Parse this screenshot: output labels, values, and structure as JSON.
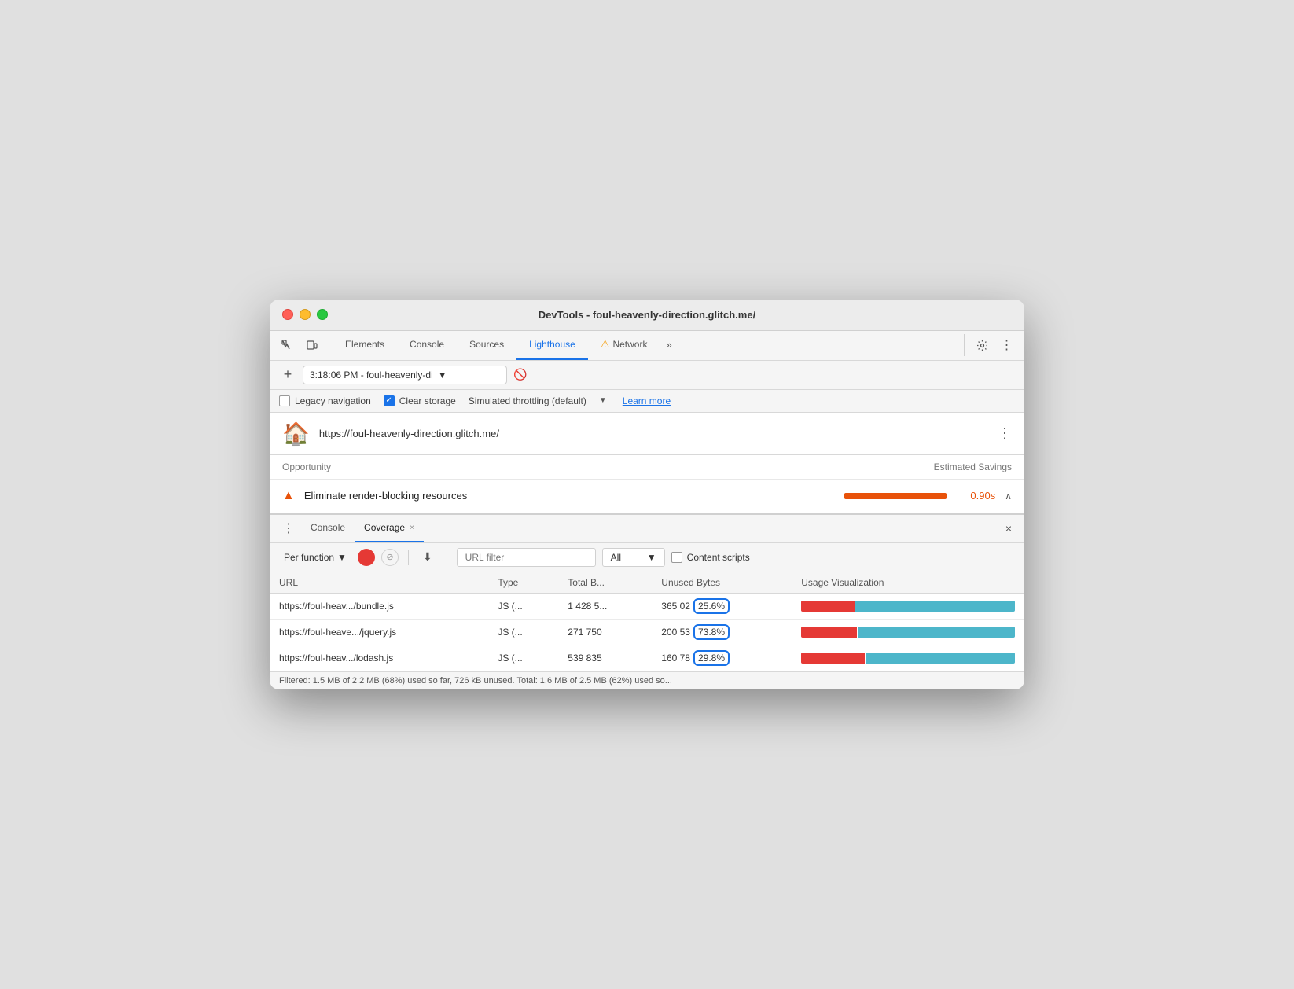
{
  "window": {
    "title": "DevTools - foul-heavenly-direction.glitch.me/"
  },
  "nav": {
    "elements": "Elements",
    "console": "Console",
    "sources": "Sources",
    "lighthouse": "Lighthouse",
    "network": "Network",
    "more": "»"
  },
  "addressbar": {
    "add": "+",
    "time_url": "3:18:06 PM - foul-heavenly-di",
    "dropdown": "▼",
    "no_entry": "🚫"
  },
  "options": {
    "legacy_nav": "Legacy navigation",
    "clear_storage": "Clear storage",
    "simulated_throttling": "Simulated throttling (default)",
    "dropdown": "▼",
    "learn_more": "Learn more"
  },
  "lighthouse_url": {
    "url": "https://foul-heavenly-direction.glitch.me/",
    "icon": "🏠"
  },
  "opportunity": {
    "header_label": "Opportunity",
    "header_savings": "Estimated Savings",
    "title": "Eliminate render-blocking resources",
    "time": "0.90s"
  },
  "coverage_panel": {
    "dots": "⋮",
    "tab_console": "Console",
    "tab_coverage": "Coverage",
    "tab_close": "×",
    "close": "×",
    "per_function": "Per function",
    "dropdown_arrow": "▼",
    "url_filter_placeholder": "URL filter",
    "all_label": "All",
    "content_scripts": "Content scripts",
    "download_icon": "⬇"
  },
  "table": {
    "headers": [
      "URL",
      "Type",
      "Total B...",
      "Unused Bytes",
      "Usage Visualization"
    ],
    "rows": [
      {
        "url": "https://foul-heav.../bundle.js",
        "type": "JS (...",
        "total": "1 428 5...",
        "unused_bytes": "365 02",
        "unused_pct": "25.6%",
        "used_pct": 25,
        "unused_bar_pct": 75
      },
      {
        "url": "https://foul-heave.../jquery.js",
        "type": "JS (...",
        "total": "271 750",
        "unused_bytes": "200 53",
        "unused_pct": "73.8%",
        "used_pct": 26,
        "unused_bar_pct": 74
      },
      {
        "url": "https://foul-heav.../lodash.js",
        "type": "JS (...",
        "total": "539 835",
        "unused_bytes": "160 78",
        "unused_pct": "29.8%",
        "used_pct": 30,
        "unused_bar_pct": 70
      }
    ]
  },
  "status_bar": {
    "text": "Filtered: 1.5 MB of 2.2 MB (68%) used so far, 726 kB unused. Total: 1.6 MB of 2.5 MB (62%) used so..."
  }
}
